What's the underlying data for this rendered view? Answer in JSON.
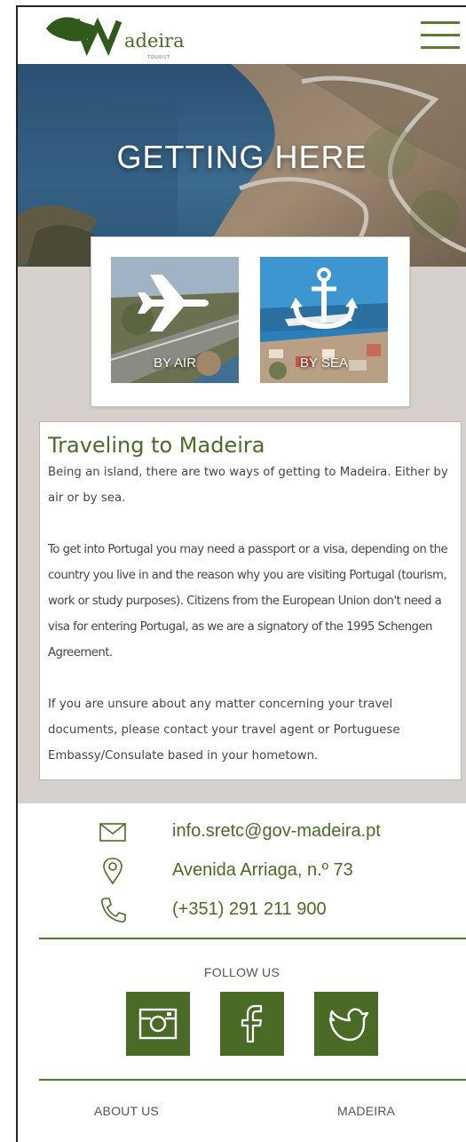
{
  "header": {
    "logo_initial": "M",
    "logo_text": "adeira",
    "logo_subtext": "TOURIST"
  },
  "hero": {
    "title": "GETTING HERE"
  },
  "transport": [
    {
      "label": "BY AIR",
      "icon": "airplane-icon"
    },
    {
      "label": "BY SEA",
      "icon": "anchor-icon"
    }
  ],
  "article": {
    "title": "Traveling to Madeira",
    "paragraphs": [
      "Being an island, there are two ways of getting to Madeira. Either by air or by sea.",
      "To get into Portugal you may need a passport or a visa, depending on the country you live in and the reason why you are visiting Portugal (tourism, work or study purposes). Citizens from the European Union don't need a visa for entering Portugal, as we are a signatory of the 1995 Schengen Agreement.",
      "If you are unsure about any matter concerning your travel documents, please contact your travel agent or Portuguese Embassy/Consulate based in your hometown."
    ]
  },
  "contact": {
    "email": "info.sretc@gov-madeira.pt",
    "address": "Avenida Arriaga, n.º 73",
    "phone": "(+351) 291 211 900"
  },
  "follow": {
    "label": "FOLLOW US",
    "networks": [
      "instagram-icon",
      "facebook-icon",
      "twitter-icon"
    ]
  },
  "footer": {
    "links": [
      "ABOUT US",
      "MADEIRA"
    ]
  },
  "colors": {
    "brand_green": "#4a6b26",
    "grey_background": "#d6d1cd",
    "rule_green": "#4f7a2c"
  }
}
